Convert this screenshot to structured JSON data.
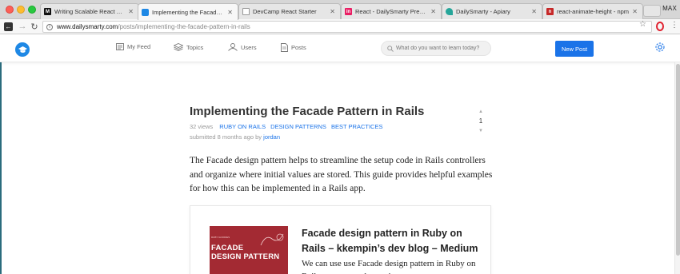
{
  "browser": {
    "profile": "MAX",
    "tabs": [
      {
        "title": "Writing Scalable React Apps",
        "favicon": "M",
        "favicon_color": "#111111",
        "active": false
      },
      {
        "title": "Implementing the Facade Pat",
        "favicon": "",
        "favicon_color": "#1e88e5",
        "active": true
      },
      {
        "title": "DevCamp React Starter",
        "favicon": "",
        "favicon_color": "#ffffff",
        "active": false
      },
      {
        "title": "React - DailySmarty Preview",
        "favicon": "in",
        "favicon_color": "#e91e63",
        "active": false
      },
      {
        "title": "DailySmarty - Apiary",
        "favicon": "",
        "favicon_color": "#26a69a",
        "active": false
      },
      {
        "title": "react-animate-height - npm",
        "favicon": "n",
        "favicon_color": "#c62828",
        "active": false
      }
    ],
    "url_host": "www.dailysmarty.com",
    "url_path": "/posts/implementing-the-facade-pattern-in-rails"
  },
  "site": {
    "nav": {
      "my_feed": "My Feed",
      "topics": "Topics",
      "users": "Users",
      "posts": "Posts"
    },
    "search_placeholder": "What do you want to learn today?",
    "new_post_label": "New Post",
    "accent_color": "#1a73e8"
  },
  "post": {
    "title": "Implementing the Facade Pattern in Rails",
    "views": "32 views",
    "tags": [
      "RUBY ON RAILS",
      "DESIGN PATTERNS",
      "BEST PRACTICES"
    ],
    "submitted_prefix": "submitted 8 months ago by",
    "author": "jordan",
    "vote_count": "1",
    "body": "The Facade design pattern helps to streamline the setup code in Rails controllers and organize where initial values are stored. This guide provides helpful examples for how this can be implemented in a Rails app.",
    "link_card": {
      "thumb_small": "RUBY GOODIES",
      "thumb_big_1": "FACADE",
      "thumb_big_2": "DESIGN PATTERN",
      "title": "Facade design pattern in Ruby on Rails – kkempin’s dev blog – Medium",
      "description": "We can use use Facade design pattern in Ruby on Rails to group and organize"
    }
  }
}
